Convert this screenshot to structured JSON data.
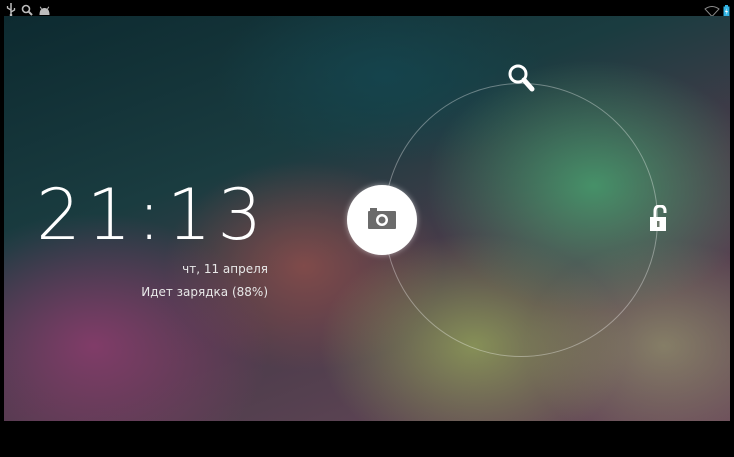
{
  "status_bar": {
    "left_icons": [
      "usb-icon",
      "search-icon",
      "android-icon"
    ],
    "right_icons": [
      "wifi-icon",
      "battery-icon"
    ]
  },
  "lockscreen": {
    "time": "21:13",
    "date": "чт, 11 апреля",
    "charging_status": "Идет зарядка (88%)",
    "targets": {
      "top": "search-icon",
      "right": "unlock-icon",
      "center": "camera-icon"
    }
  },
  "colors": {
    "text": "#ffffff",
    "ring": "#ffffff",
    "status_bar_bg": "#000000"
  }
}
